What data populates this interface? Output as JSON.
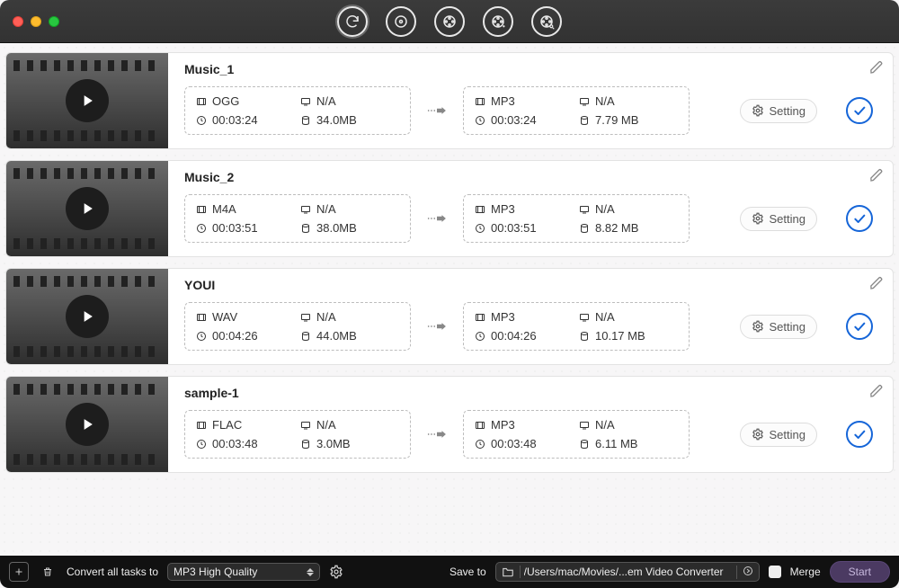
{
  "toolbar": {
    "icons": [
      "refresh-icon",
      "disc-icon",
      "reel-icon",
      "reel-add-icon",
      "reel-search-icon"
    ]
  },
  "items": [
    {
      "title": "Music_1",
      "src": {
        "format": "OGG",
        "res": "N/A",
        "duration": "00:03:24",
        "size": "34.0MB"
      },
      "dst": {
        "format": "MP3",
        "res": "N/A",
        "duration": "00:03:24",
        "size": "7.79 MB"
      },
      "setting_label": "Setting"
    },
    {
      "title": "Music_2",
      "src": {
        "format": "M4A",
        "res": "N/A",
        "duration": "00:03:51",
        "size": "38.0MB"
      },
      "dst": {
        "format": "MP3",
        "res": "N/A",
        "duration": "00:03:51",
        "size": "8.82 MB"
      },
      "setting_label": "Setting"
    },
    {
      "title": "YOUI",
      "src": {
        "format": "WAV",
        "res": "N/A",
        "duration": "00:04:26",
        "size": "44.0MB"
      },
      "dst": {
        "format": "MP3",
        "res": "N/A",
        "duration": "00:04:26",
        "size": "10.17 MB"
      },
      "setting_label": "Setting"
    },
    {
      "title": "sample-1",
      "src": {
        "format": "FLAC",
        "res": "N/A",
        "duration": "00:03:48",
        "size": "3.0MB"
      },
      "dst": {
        "format": "MP3",
        "res": "N/A",
        "duration": "00:03:48",
        "size": "6.11 MB"
      },
      "setting_label": "Setting"
    }
  ],
  "bottom": {
    "convert_label": "Convert all tasks to",
    "preset": "MP3 High Quality",
    "saveto_label": "Save to",
    "path": "/Users/mac/Movies/...em Video Converter",
    "merge_label": "Merge",
    "start_label": "Start"
  }
}
